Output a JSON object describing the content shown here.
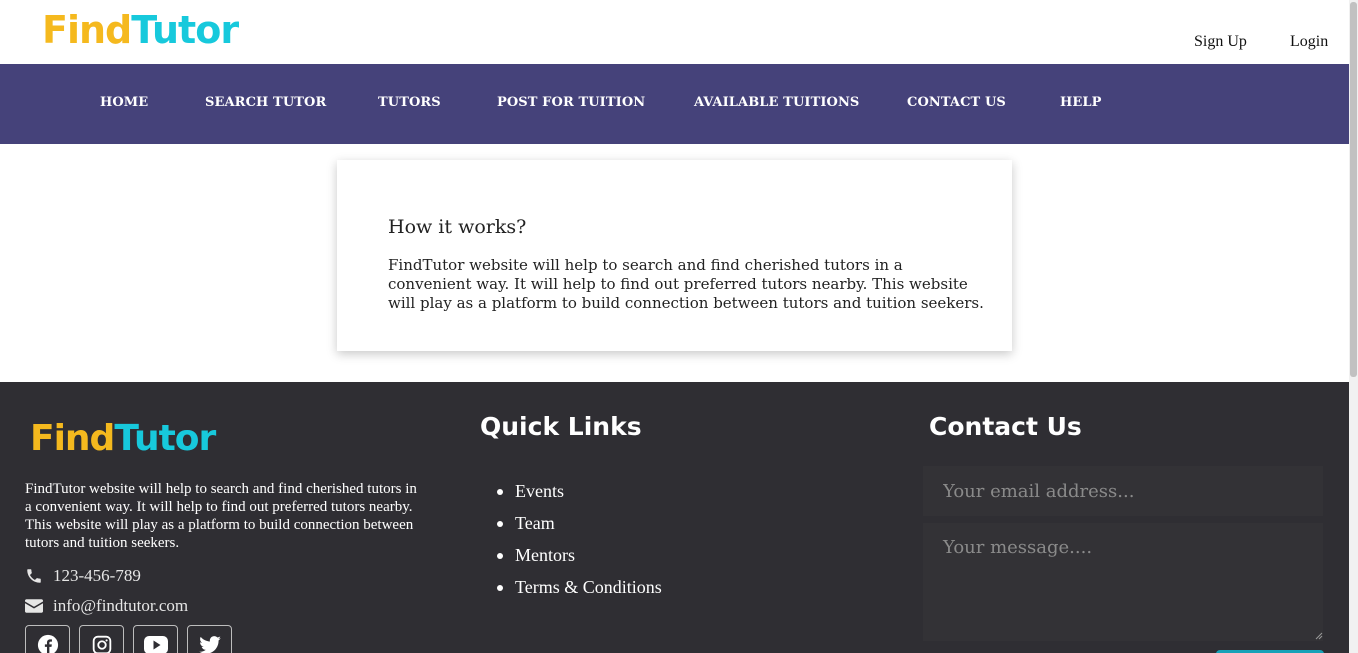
{
  "header": {
    "logo": {
      "find": "Find",
      "tutor": "Tutor"
    },
    "signup_label": "Sign Up",
    "login_label": "Login"
  },
  "nav": {
    "items": [
      {
        "label": "HOME"
      },
      {
        "label": "SEARCH TUTOR"
      },
      {
        "label": "TUTORS"
      },
      {
        "label": "POST FOR TUITION"
      },
      {
        "label": "AVAILABLE TUITIONS"
      },
      {
        "label": "CONTACT US"
      },
      {
        "label": "HELP"
      }
    ]
  },
  "card": {
    "title": "How it works?",
    "text": "FindTutor website will help to search and find cherished tutors in a convenient way. It will help to find out preferred tutors nearby. This website will play as a platform to build connection between tutors and tuition seekers."
  },
  "footer": {
    "logo": {
      "find": "Find",
      "tutor": "Tutor"
    },
    "description": "FindTutor website will help to search and find cherished tutors in a convenient way. It will help to find out preferred tutors nearby. This website will play as a platform to build connection between tutors and tuition seekers.",
    "phone": "123-456-789",
    "email": "info@findtutor.com",
    "socials": [
      "facebook-icon",
      "instagram-icon",
      "youtube-icon",
      "twitter-icon"
    ],
    "quick_links_title": "Quick Links",
    "quick_links": [
      {
        "label": "Events"
      },
      {
        "label": "Team"
      },
      {
        "label": "Mentors"
      },
      {
        "label": "Terms & Conditions"
      }
    ],
    "contact_title": "Contact Us",
    "email_placeholder": "Your email address...",
    "message_placeholder": "Your message...."
  },
  "colors": {
    "nav_bg": "#45427a",
    "footer_bg": "#2f2e33",
    "logo_find": "#f5b91e",
    "logo_tutor": "#17c9dc"
  }
}
